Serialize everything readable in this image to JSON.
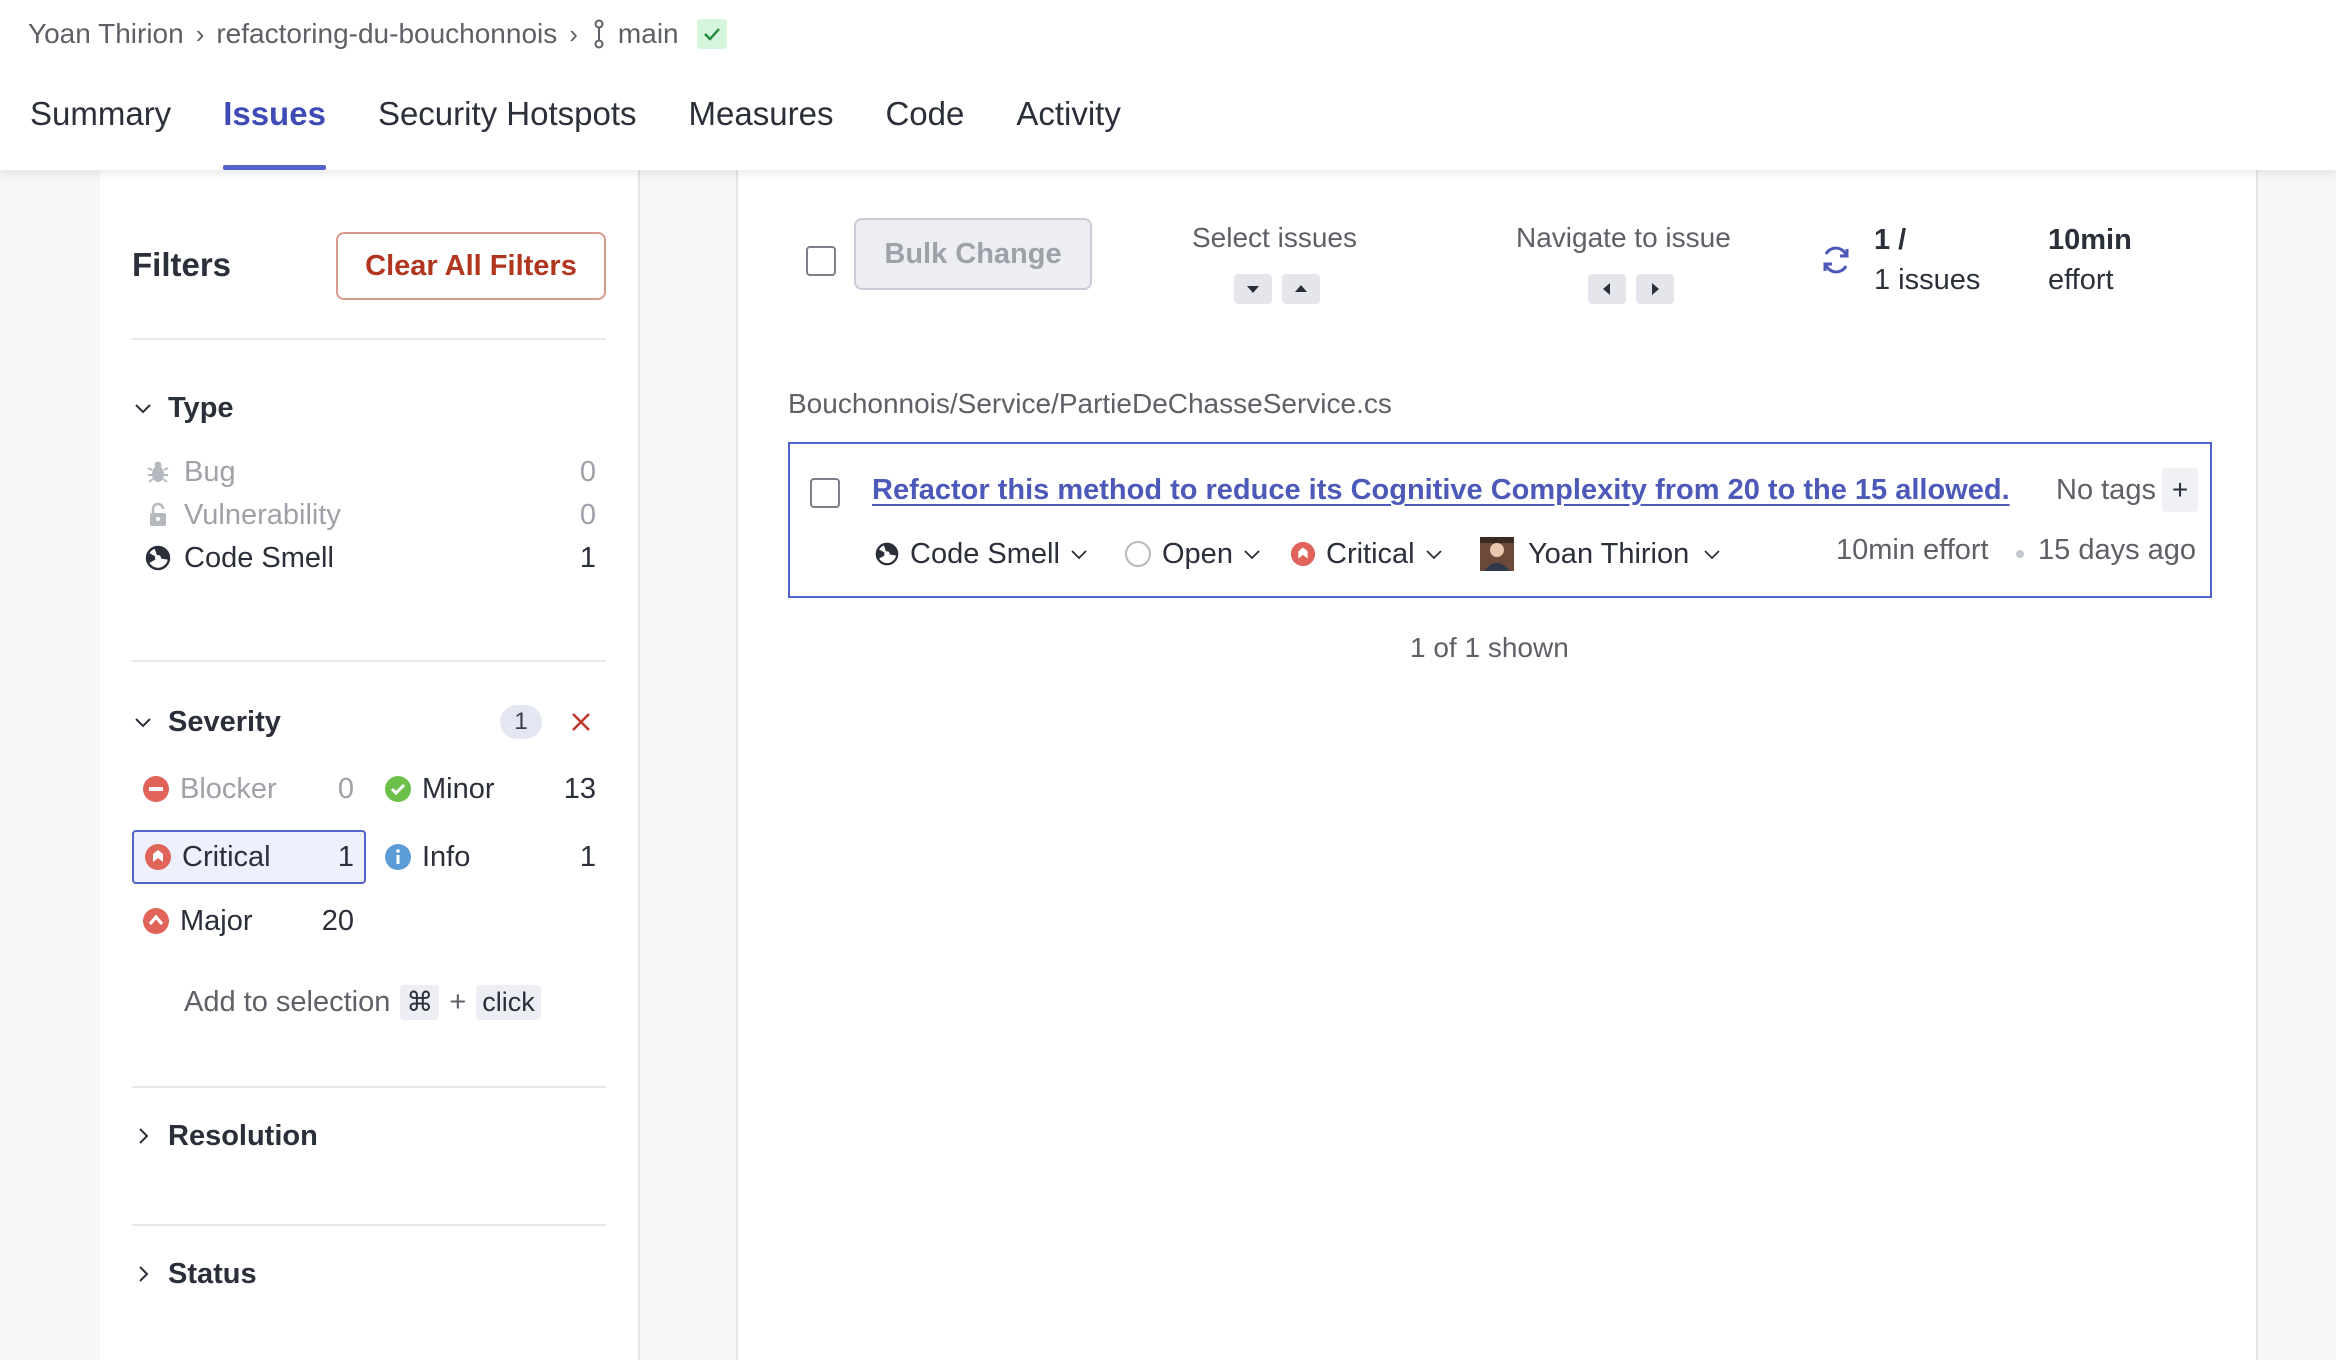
{
  "breadcrumb": {
    "owner": "Yoan Thirion",
    "project": "refactoring-du-bouchonnois",
    "branch": "main"
  },
  "nav": {
    "tabs": [
      {
        "label": "Summary",
        "active": false
      },
      {
        "label": "Issues",
        "active": true
      },
      {
        "label": "Security Hotspots",
        "active": false
      },
      {
        "label": "Measures",
        "active": false
      },
      {
        "label": "Code",
        "active": false
      },
      {
        "label": "Activity",
        "active": false
      }
    ]
  },
  "filters": {
    "title": "Filters",
    "clear_label": "Clear All Filters",
    "type": {
      "title": "Type",
      "items": [
        {
          "label": "Bug",
          "count": "0",
          "icon": "bug-icon"
        },
        {
          "label": "Vulnerability",
          "count": "0",
          "icon": "lock-icon"
        },
        {
          "label": "Code Smell",
          "count": "1",
          "icon": "code-smell-icon"
        }
      ]
    },
    "severity": {
      "title": "Severity",
      "selected_count": "1",
      "items": [
        {
          "label": "Blocker",
          "count": "0",
          "icon": "blocker-icon"
        },
        {
          "label": "Minor",
          "count": "13",
          "icon": "minor-icon"
        },
        {
          "label": "Critical",
          "count": "1",
          "icon": "critical-icon",
          "selected": true
        },
        {
          "label": "Info",
          "count": "1",
          "icon": "info-icon"
        },
        {
          "label": "Major",
          "count": "20",
          "icon": "major-icon"
        }
      ],
      "hint": {
        "text": "Add to selection",
        "key": "⌘",
        "plus": "+",
        "action": "click"
      }
    },
    "resolution_title": "Resolution",
    "status_title": "Status"
  },
  "toolbar": {
    "bulk_label": "Bulk Change",
    "select_label": "Select issues",
    "navigate_label": "Navigate to issue",
    "count_line1": "1 /",
    "count_line2": "1 issues",
    "effort_line1": "10min",
    "effort_line2": "effort"
  },
  "issues": {
    "file_path": "Bouchonnois/Service/PartieDeChasseService.cs",
    "items": [
      {
        "title": "Refactor this method to reduce its Cognitive Complexity from 20 to the 15 allowed.",
        "tags": "No tags",
        "type": "Code Smell",
        "status": "Open",
        "severity": "Critical",
        "assignee": "Yoan Thirion",
        "effort": "10min effort",
        "age": "15 days ago"
      }
    ],
    "shown_text": "1 of 1 shown"
  },
  "colors": {
    "accent": "#5563c9",
    "link": "#4c59b8",
    "danger": "#b1361f",
    "blocker": "#e0645a",
    "minor": "#6cc04a",
    "info": "#5b9bd6"
  }
}
